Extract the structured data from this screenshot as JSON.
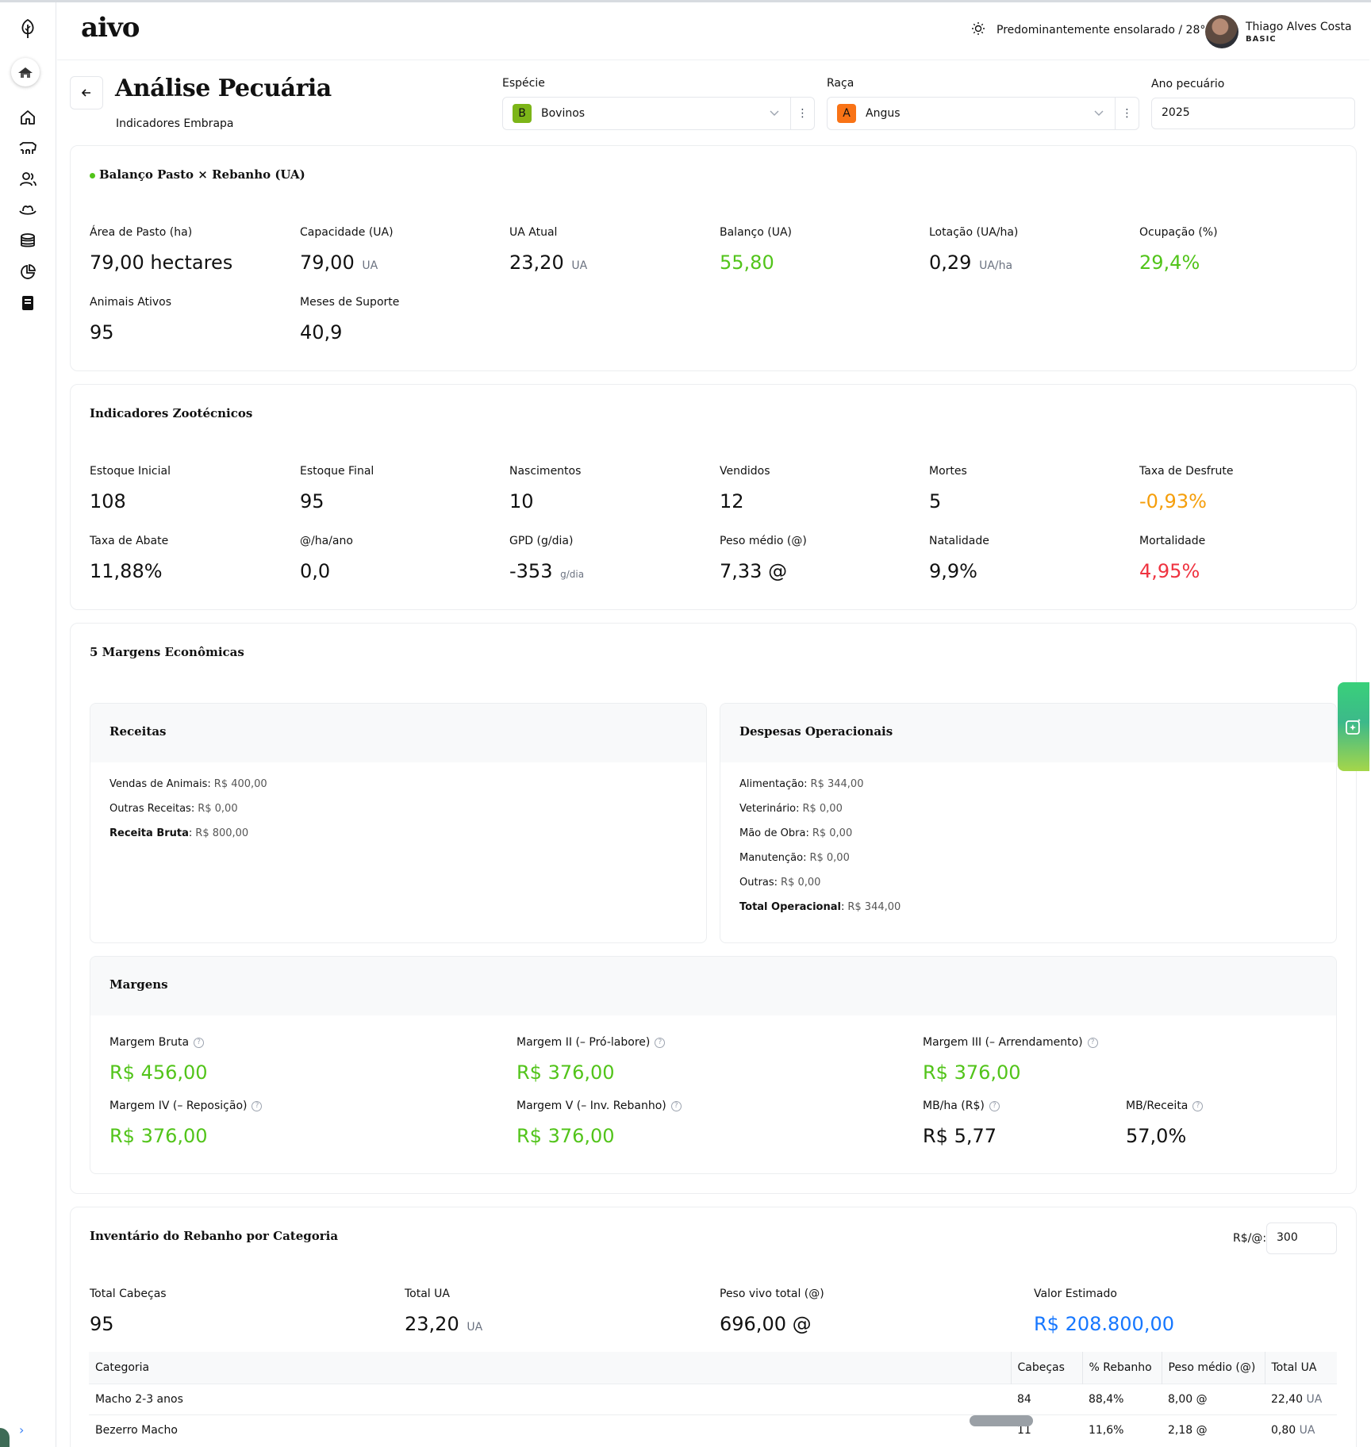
{
  "header": {
    "logo": "aivo",
    "weather": "Predominantemente ensolarado / 28°",
    "user_name": "Thiago Alves Costa",
    "user_plan": "BASIC"
  },
  "sidebar": {
    "icons": [
      "leaf-icon",
      "farm-icon",
      "home-icon",
      "cattle-icon",
      "users-icon",
      "hat-icon",
      "coins-icon",
      "pie-chart-icon",
      "receipt-icon"
    ],
    "expand_icon": "chevron-right-icon"
  },
  "page": {
    "title": "Análise Pecuária",
    "subtitle": "Indicadores Embrapa"
  },
  "filters": {
    "species_label": "Espécie",
    "species_badge": "B",
    "species_value": "Bovinos",
    "breed_label": "Raça",
    "breed_badge": "A",
    "breed_value": "Angus",
    "year_label": "Ano pecuário",
    "year_value": "2025"
  },
  "balance": {
    "title": "Balanço Pasto × Rebanho (UA)",
    "metrics": [
      {
        "label": "Área de Pasto (ha)",
        "value": "79,00 hectares",
        "unit": ""
      },
      {
        "label": "Capacidade (UA)",
        "value": "79,00",
        "unit": "UA"
      },
      {
        "label": "UA Atual",
        "value": "23,20",
        "unit": "UA"
      },
      {
        "label": "Balanço (UA)",
        "value": "55,80",
        "unit": ""
      },
      {
        "label": "Lotação (UA/ha)",
        "value": "0,29",
        "unit": "UA/ha"
      },
      {
        "label": "Ocupação (%)",
        "value": "29,4%",
        "unit": ""
      },
      {
        "label": "Animais Ativos",
        "value": "95",
        "unit": ""
      },
      {
        "label": "Meses de Suporte",
        "value": "40,9",
        "unit": ""
      }
    ]
  },
  "zoo": {
    "title": "Indicadores Zootécnicos",
    "metrics": [
      {
        "label": "Estoque Inicial",
        "value": "108",
        "unit": ""
      },
      {
        "label": "Estoque Final",
        "value": "95",
        "unit": ""
      },
      {
        "label": "Nascimentos",
        "value": "10",
        "unit": ""
      },
      {
        "label": "Vendidos",
        "value": "12",
        "unit": ""
      },
      {
        "label": "Mortes",
        "value": "5",
        "unit": ""
      },
      {
        "label": "Taxa de Desfrute",
        "value": "-0,93%",
        "unit": ""
      },
      {
        "label": "Taxa de Abate",
        "value": "11,88%",
        "unit": ""
      },
      {
        "label": "@/ha/ano",
        "value": "0,0",
        "unit": ""
      },
      {
        "label": "GPD (g/dia)",
        "value": "-353",
        "unit": "g/dia"
      },
      {
        "label": "Peso médio (@)",
        "value": "7,33 @",
        "unit": ""
      },
      {
        "label": "Natalidade",
        "value": "9,9%",
        "unit": ""
      },
      {
        "label": "Mortalidade",
        "value": "4,95%",
        "unit": ""
      }
    ]
  },
  "margins_section": {
    "title": "5 Margens Econômicas",
    "revenue": {
      "title": "Receitas",
      "items": [
        {
          "k": "Vendas de Animais",
          "v": "R$ 400,00"
        },
        {
          "k": "Outras Receitas",
          "v": "R$ 0,00"
        },
        {
          "k": "Receita Bruta",
          "v": "R$ 800,00"
        }
      ]
    },
    "expenses": {
      "title": "Despesas Operacionais",
      "items": [
        {
          "k": "Alimentação",
          "v": "R$ 344,00"
        },
        {
          "k": "Veterinário",
          "v": "R$ 0,00"
        },
        {
          "k": "Mão de Obra",
          "v": "R$ 0,00"
        },
        {
          "k": "Manutenção",
          "v": "R$ 0,00"
        },
        {
          "k": "Outras",
          "v": "R$ 0,00"
        },
        {
          "k": "Total Operacional",
          "v": "R$ 344,00"
        }
      ]
    },
    "margins": {
      "title": "Margens",
      "items": [
        {
          "label": "Margem Bruta",
          "value": "R$ 456,00"
        },
        {
          "label": "Margem II (– Pró-labore)",
          "value": "R$ 376,00"
        },
        {
          "label": "Margem III (– Arrendamento)",
          "value": "R$ 376,00"
        },
        {
          "label": "Margem IV (– Reposição)",
          "value": "R$ 376,00"
        },
        {
          "label": "Margem V (– Inv. Rebanho)",
          "value": "R$ 376,00"
        },
        {
          "label": "MB/ha (R$)",
          "value": "R$ 5,77"
        },
        {
          "label": "MB/Receita",
          "value": "57,0%"
        }
      ]
    }
  },
  "inventory": {
    "title": "Inventário do Rebanho por Categoria",
    "price_label": "R$/@:",
    "price_value": "300",
    "totals": [
      {
        "label": "Total Cabeças",
        "value": "95",
        "unit": ""
      },
      {
        "label": "Total UA",
        "value": "23,20",
        "unit": "UA"
      },
      {
        "label": "Peso vivo total (@)",
        "value": "696,00 @",
        "unit": ""
      },
      {
        "label": "Valor Estimado",
        "value": "R$ 208.800,00",
        "unit": ""
      }
    ],
    "columns": [
      "Categoria",
      "Cabeças",
      "% Rebanho",
      "Peso médio (@)",
      "Total UA"
    ],
    "rows": [
      {
        "categoria": "Macho 2-3 anos",
        "cabecas": "84",
        "pct": "88,4%",
        "peso": "8,00 @",
        "ua": "22,40",
        "ua_unit": "UA"
      },
      {
        "categoria": "Bezerro Macho",
        "cabecas": "11",
        "pct": "11,6%",
        "peso": "2,18 @",
        "ua": "0,80",
        "ua_unit": "UA"
      }
    ]
  },
  "colors": {
    "positive": "#52c41a",
    "warning": "#f59e0b",
    "danger": "#ef3340",
    "money": "#1677ff"
  }
}
